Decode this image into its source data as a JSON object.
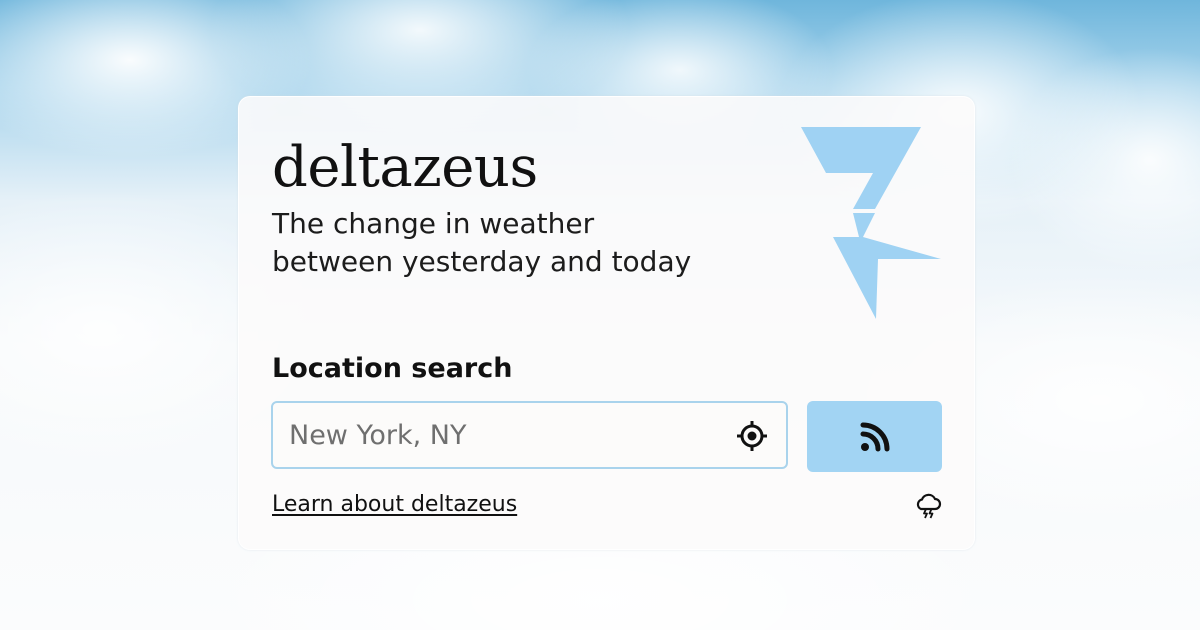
{
  "brand": {
    "name": "deltazeus",
    "tagline_line1": "The change in weather",
    "tagline_line2": "between yesterday and today"
  },
  "search": {
    "label": "Location search",
    "placeholder": "New York, NY",
    "value": "",
    "locate_icon": "crosshair-target-icon",
    "submit_icon": "rss-feed-icon"
  },
  "footer": {
    "learn_link": "Learn about deltazeus",
    "weather_icon": "thunderstorm-cloud-icon"
  },
  "colors": {
    "accent": "#a2d4f3",
    "logo": "#9fd2f3",
    "input_border": "#a9d3ec",
    "text": "#111111"
  }
}
